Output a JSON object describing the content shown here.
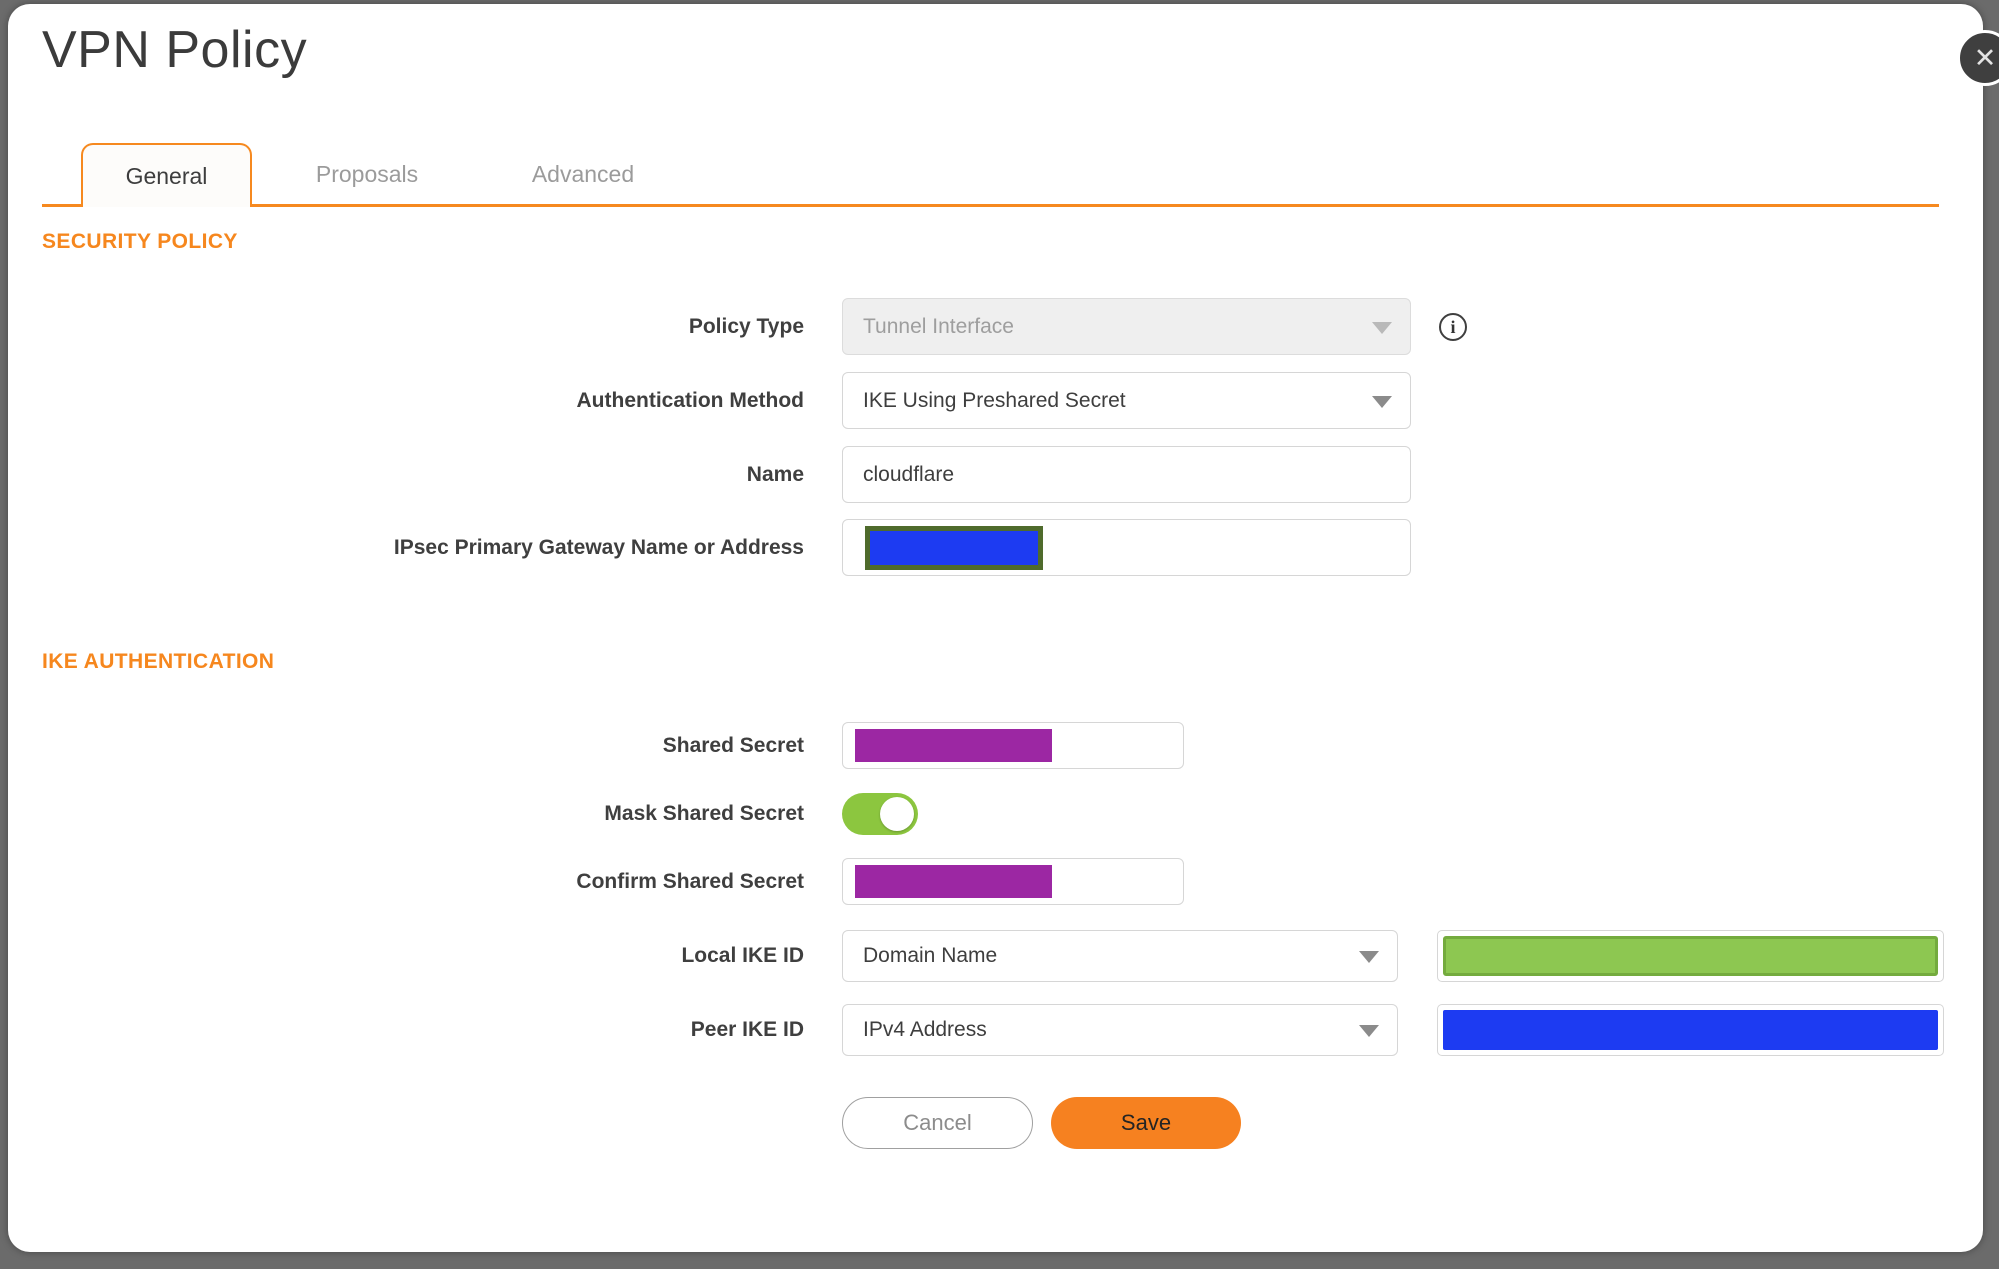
{
  "dialog": {
    "title": "VPN Policy",
    "close_icon": "✕"
  },
  "tabs": [
    {
      "label": "General",
      "active": true
    },
    {
      "label": "Proposals",
      "active": false
    },
    {
      "label": "Advanced",
      "active": false
    }
  ],
  "sections": {
    "security_policy": {
      "heading": "SECURITY POLICY"
    },
    "ike_authentication": {
      "heading": "IKE AUTHENTICATION"
    }
  },
  "form": {
    "policy_type": {
      "label": "Policy Type",
      "value": "Tunnel Interface",
      "disabled": true,
      "info_icon_glyph": "i"
    },
    "authentication_method": {
      "label": "Authentication Method",
      "value": "IKE Using Preshared Secret"
    },
    "name": {
      "label": "Name",
      "value": "cloudflare"
    },
    "ipsec_gateway": {
      "label": "IPsec Primary Gateway Name or Address",
      "redacted": true
    },
    "shared_secret": {
      "label": "Shared Secret",
      "redacted": true
    },
    "mask_shared_secret": {
      "label": "Mask Shared Secret",
      "state": "on"
    },
    "confirm_shared_secret": {
      "label": "Confirm Shared Secret",
      "redacted": true
    },
    "local_ike_id": {
      "label": "Local IKE ID",
      "type_value": "Domain Name",
      "redacted": true
    },
    "peer_ike_id": {
      "label": "Peer IKE ID",
      "type_value": "IPv4 Address",
      "redacted": true
    }
  },
  "buttons": {
    "cancel": "Cancel",
    "save": "Save"
  },
  "colors": {
    "backdrop": "#6b6b6b",
    "accent_orange": "#f6871e",
    "save_orange": "#f68120",
    "redaction_purple": "#9c27a3",
    "redaction_blue": "#1d3bf2",
    "redaction_green": "#8dc751",
    "gateway_redaction_border": "#4f6b2c",
    "toggle_green": "#8cc63f"
  }
}
